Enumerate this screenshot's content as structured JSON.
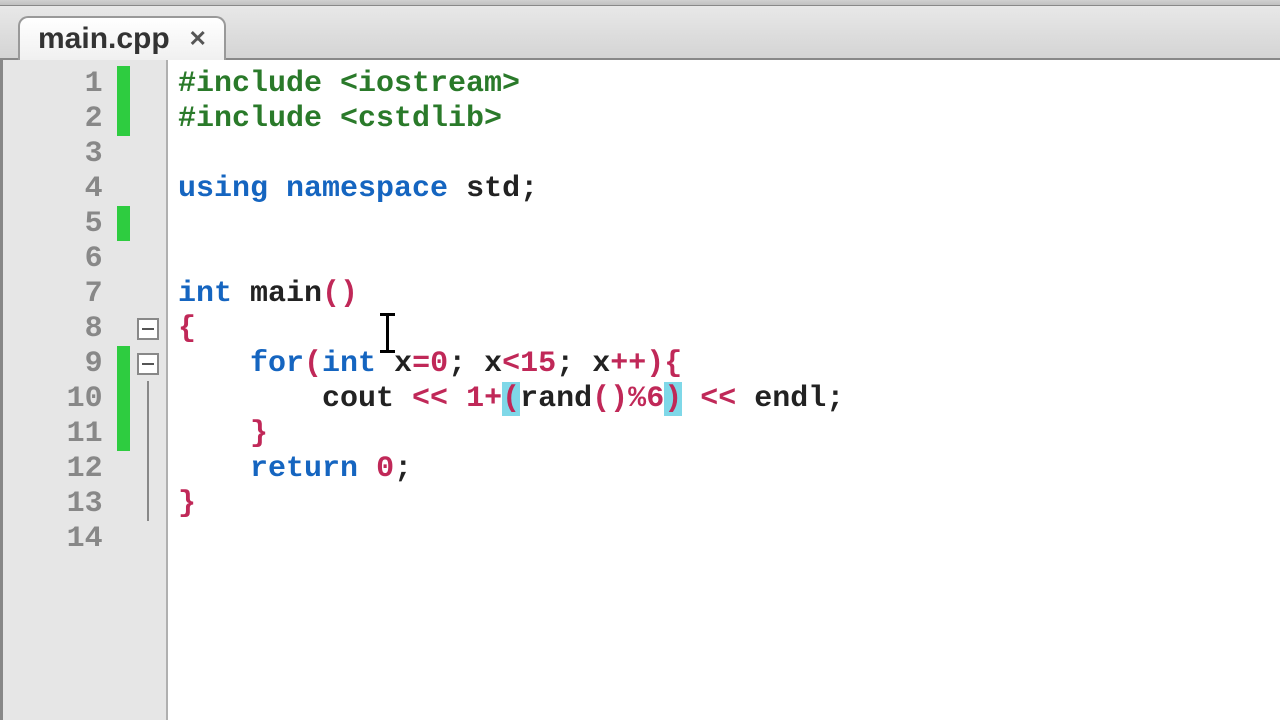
{
  "tab": {
    "label": "main.cpp"
  },
  "lines": [
    {
      "num": "1",
      "change": true,
      "fold": "",
      "tokens": [
        {
          "t": "#include ",
          "c": "pp"
        },
        {
          "t": "<iostream>",
          "c": "pp"
        }
      ]
    },
    {
      "num": "2",
      "change": true,
      "fold": "",
      "tokens": [
        {
          "t": "#include ",
          "c": "pp"
        },
        {
          "t": "<cstdlib>",
          "c": "pp"
        }
      ]
    },
    {
      "num": "3",
      "change": false,
      "fold": "",
      "tokens": []
    },
    {
      "num": "4",
      "change": false,
      "fold": "",
      "tokens": [
        {
          "t": "using",
          "c": "kw"
        },
        {
          "t": " ",
          "c": ""
        },
        {
          "t": "namespace",
          "c": "kw"
        },
        {
          "t": " std",
          "c": ""
        },
        {
          "t": ";",
          "c": ""
        }
      ]
    },
    {
      "num": "5",
      "change": true,
      "fold": "",
      "tokens": []
    },
    {
      "num": "6",
      "change": false,
      "fold": "",
      "tokens": []
    },
    {
      "num": "7",
      "change": false,
      "fold": "",
      "tokens": [
        {
          "t": "int",
          "c": "kw"
        },
        {
          "t": " main",
          "c": ""
        },
        {
          "t": "(",
          "c": "paren"
        },
        {
          "t": ")",
          "c": "paren"
        }
      ]
    },
    {
      "num": "8",
      "change": false,
      "fold": "box",
      "tokens": [
        {
          "t": "{",
          "c": "brace"
        }
      ]
    },
    {
      "num": "9",
      "change": true,
      "fold": "box",
      "tokens": [
        {
          "t": "    ",
          "c": ""
        },
        {
          "t": "for",
          "c": "kw"
        },
        {
          "t": "(",
          "c": "paren"
        },
        {
          "t": "int",
          "c": "kw"
        },
        {
          "t": " x",
          "c": ""
        },
        {
          "t": "=",
          "c": "op"
        },
        {
          "t": "0",
          "c": "num"
        },
        {
          "t": ";",
          "c": ""
        },
        {
          "t": " x",
          "c": ""
        },
        {
          "t": "<",
          "c": "op"
        },
        {
          "t": "15",
          "c": "num"
        },
        {
          "t": ";",
          "c": ""
        },
        {
          "t": " x",
          "c": ""
        },
        {
          "t": "++",
          "c": "op"
        },
        {
          "t": ")",
          "c": "paren"
        },
        {
          "t": "{",
          "c": "brace"
        }
      ]
    },
    {
      "num": "10",
      "change": true,
      "fold": "line",
      "tokens": [
        {
          "t": "        cout ",
          "c": ""
        },
        {
          "t": "<<",
          "c": "op"
        },
        {
          "t": " ",
          "c": ""
        },
        {
          "t": "1",
          "c": "num"
        },
        {
          "t": "+",
          "c": "op"
        },
        {
          "t": "(",
          "c": "hlparen"
        },
        {
          "t": "rand",
          "c": ""
        },
        {
          "t": "(",
          "c": "paren"
        },
        {
          "t": ")",
          "c": "paren"
        },
        {
          "t": "%",
          "c": "op"
        },
        {
          "t": "6",
          "c": "num"
        },
        {
          "t": ")",
          "c": "hlparen"
        },
        {
          "t": " ",
          "c": ""
        },
        {
          "t": "<<",
          "c": "op"
        },
        {
          "t": " endl",
          "c": ""
        },
        {
          "t": ";",
          "c": ""
        }
      ]
    },
    {
      "num": "11",
      "change": true,
      "fold": "line",
      "tokens": [
        {
          "t": "    ",
          "c": ""
        },
        {
          "t": "}",
          "c": "brace"
        }
      ]
    },
    {
      "num": "12",
      "change": false,
      "fold": "line",
      "tokens": [
        {
          "t": "    ",
          "c": ""
        },
        {
          "t": "return",
          "c": "kw"
        },
        {
          "t": " ",
          "c": ""
        },
        {
          "t": "0",
          "c": "num"
        },
        {
          "t": ";",
          "c": ""
        }
      ]
    },
    {
      "num": "13",
      "change": false,
      "fold": "line",
      "tokens": [
        {
          "t": "}",
          "c": "brace"
        }
      ]
    },
    {
      "num": "14",
      "change": false,
      "fold": "",
      "tokens": []
    }
  ]
}
